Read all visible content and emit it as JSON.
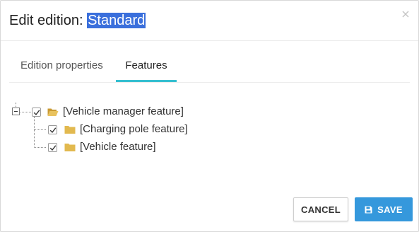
{
  "dialog": {
    "title_prefix": "Edit edition: ",
    "title_selected": "Standard",
    "close_icon": "close-icon"
  },
  "tabs": [
    {
      "label": "Edition properties",
      "active": false
    },
    {
      "label": "Features",
      "active": true
    }
  ],
  "tree": {
    "root": {
      "label": "[Vehicle manager feature]",
      "checked": true,
      "expanded": true,
      "icon": "folder-open-icon"
    },
    "children": [
      {
        "label": "[Charging pole feature]",
        "checked": true,
        "icon": "folder-icon"
      },
      {
        "label": "[Vehicle feature]",
        "checked": true,
        "icon": "folder-icon"
      }
    ]
  },
  "footer": {
    "cancel_label": "CANCEL",
    "save_label": "SAVE",
    "save_icon": "floppy-disk-icon"
  },
  "colors": {
    "accent_tab": "#36bfd0",
    "primary": "#3598dc",
    "selection": "#3a6fdc",
    "folder": "#e2b94f"
  }
}
